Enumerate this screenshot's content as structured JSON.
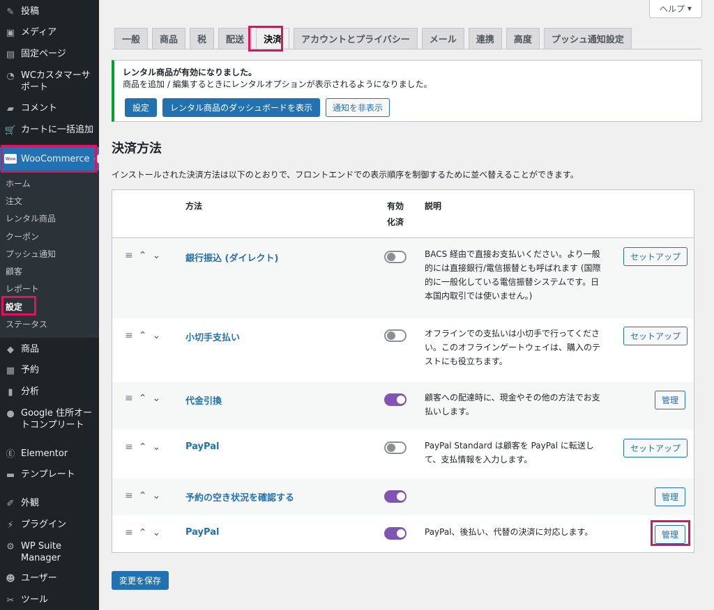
{
  "sidebar": {
    "menu": [
      {
        "label": "投稿",
        "icon": "pin-icon"
      },
      {
        "label": "メディア",
        "icon": "media-icon"
      },
      {
        "label": "固定ページ",
        "icon": "page-icon"
      },
      {
        "label": "WCカスタマーサ\nポート",
        "icon": "headset-icon"
      },
      {
        "label": "コメント",
        "icon": "comment-icon"
      },
      {
        "label": "カートに一括追加",
        "icon": "cart-icon"
      }
    ],
    "woocommerce": {
      "label": "WooCommerce",
      "logo": "Woo"
    },
    "submenu": [
      {
        "label": "ホーム"
      },
      {
        "label": "注文"
      },
      {
        "label": "レンタル商品"
      },
      {
        "label": "クーポン"
      },
      {
        "label": "プッシュ通知"
      },
      {
        "label": "顧客"
      },
      {
        "label": "レポート"
      },
      {
        "label": "設定"
      },
      {
        "label": "ステータス"
      }
    ],
    "menu2": [
      {
        "label": "商品",
        "icon": "box-icon"
      },
      {
        "label": "予約",
        "icon": "calendar-icon"
      },
      {
        "label": "分析",
        "icon": "chart-icon"
      },
      {
        "label": "Google 住所オー\nトコンプリート",
        "icon": "location-icon"
      },
      {
        "label": "Elementor",
        "icon": "elementor-icon"
      },
      {
        "label": "テンプレート",
        "icon": "folder-icon"
      },
      {
        "label": "外観",
        "icon": "brush-icon"
      },
      {
        "label": "プラグイン",
        "icon": "plugin-icon"
      },
      {
        "label": "WP Suite\nManager",
        "icon": "gear-icon"
      },
      {
        "label": "ユーザー",
        "icon": "user-icon"
      },
      {
        "label": "ツール",
        "icon": "wrench-icon"
      }
    ]
  },
  "help": {
    "label": "ヘルプ",
    "arrow": "▼"
  },
  "tabs": [
    {
      "label": "一般"
    },
    {
      "label": "商品"
    },
    {
      "label": "税"
    },
    {
      "label": "配送"
    },
    {
      "label": "決済"
    },
    {
      "label": "アカウントとプライバシー"
    },
    {
      "label": "メール"
    },
    {
      "label": "連携"
    },
    {
      "label": "高度"
    },
    {
      "label": "プッシュ通知設定"
    }
  ],
  "active_tab": "決済",
  "notice": {
    "title": "レンタル商品が有効になりました。",
    "body": "商品を追加 / 編集するときにレンタルオプションが表示されるようになりました。",
    "buttons": [
      "設定",
      "レンタル商品のダッシュボードを表示",
      "通知を非表示"
    ]
  },
  "page": {
    "heading": "決済方法",
    "description": "インストールされた決済方法は以下のとおりで、フロントエンドでの表示順序を制御するために並べ替えることができます。"
  },
  "table": {
    "headers": {
      "method": "方法",
      "enabled": "有効\n化済",
      "description": "説明"
    },
    "rows": [
      {
        "name": "銀行振込 (ダイレクト)",
        "enabled": false,
        "description": "BACS 経由で直接お支払いください。より一般的には直接銀行/電信振替とも呼ばれます (国際的に一般化している電信振替システムです。日本国内取引では使いません。)",
        "action": "セットアップ"
      },
      {
        "name": "小切手支払い",
        "enabled": false,
        "description": "オフラインでの支払いは小切手で行ってください。このオフラインゲートウェイは、購入のテストにも役立ちます。",
        "action": "セットアップ"
      },
      {
        "name": "代金引換",
        "enabled": true,
        "description": "顧客への配達時に、現金やその他の方法でお支払いします。",
        "action": "管理"
      },
      {
        "name": "PayPal",
        "enabled": false,
        "description": "PayPal Standard は顧客を PayPal に転送して、支払情報を入力します。",
        "action": "セットアップ"
      },
      {
        "name": "予約の空き状況を確認する",
        "enabled": true,
        "description": "",
        "action": "管理"
      },
      {
        "name": "PayPal",
        "enabled": true,
        "description": "PayPal、後払い、代替の決済に対応します。",
        "action": "管理"
      }
    ]
  },
  "save_label": "変更を保存",
  "colors": {
    "accent": "#2271b1",
    "highlight": "#e0115f",
    "toggle_on": "#7f54b3",
    "sidebar": "#1d2327"
  }
}
